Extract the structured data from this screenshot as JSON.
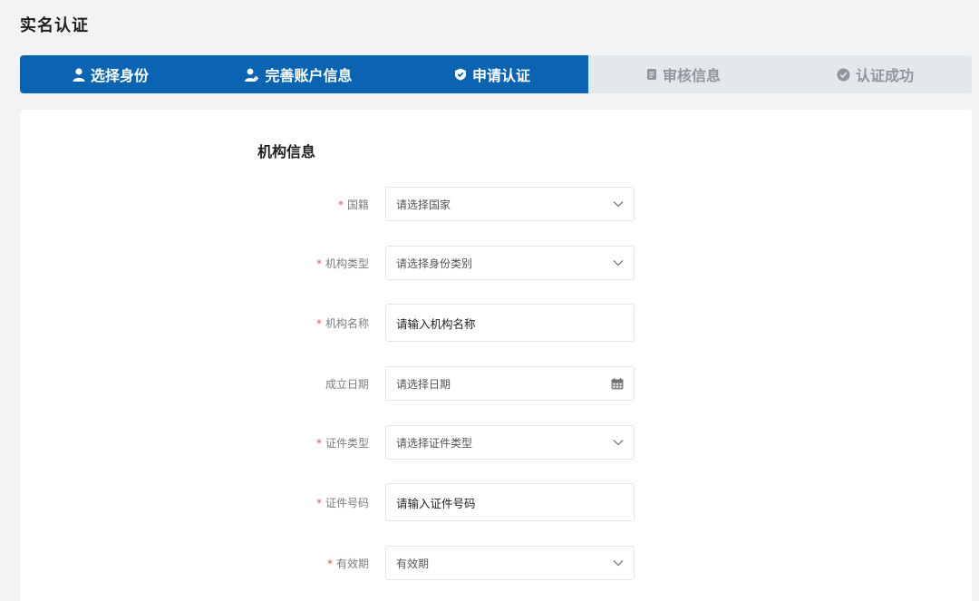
{
  "page": {
    "title": "实名认证"
  },
  "steps": [
    {
      "label": "选择身份",
      "icon": "user-icon",
      "status": "done"
    },
    {
      "label": "完善账户信息",
      "icon": "user-add-icon",
      "status": "done"
    },
    {
      "label": "申请认证",
      "icon": "shield-check-icon",
      "status": "current"
    },
    {
      "label": "审核信息",
      "icon": "document-icon",
      "status": "pending"
    },
    {
      "label": "认证成功",
      "icon": "check-circle-icon",
      "status": "pending"
    }
  ],
  "colors": {
    "active_step_bg": "#0b64b1",
    "inactive_step_bg": "#e4e7eb",
    "required_mark": "#e05656"
  },
  "form": {
    "section_title": "机构信息",
    "required_mark": "*",
    "fields": [
      {
        "label": "国籍",
        "required": true,
        "type": "select",
        "placeholder": "请选择国家"
      },
      {
        "label": "机构类型",
        "required": true,
        "type": "select",
        "placeholder": "请选择身份类别"
      },
      {
        "label": "机构名称",
        "required": true,
        "type": "input",
        "placeholder": "请输入机构名称"
      },
      {
        "label": "成立日期",
        "required": false,
        "type": "date",
        "placeholder": "请选择日期"
      },
      {
        "label": "证件类型",
        "required": true,
        "type": "select",
        "placeholder": "请选择证件类型"
      },
      {
        "label": "证件号码",
        "required": true,
        "type": "input",
        "placeholder": "请输入证件号码"
      },
      {
        "label": "有效期",
        "required": true,
        "type": "select",
        "placeholder": "有效期"
      }
    ]
  }
}
